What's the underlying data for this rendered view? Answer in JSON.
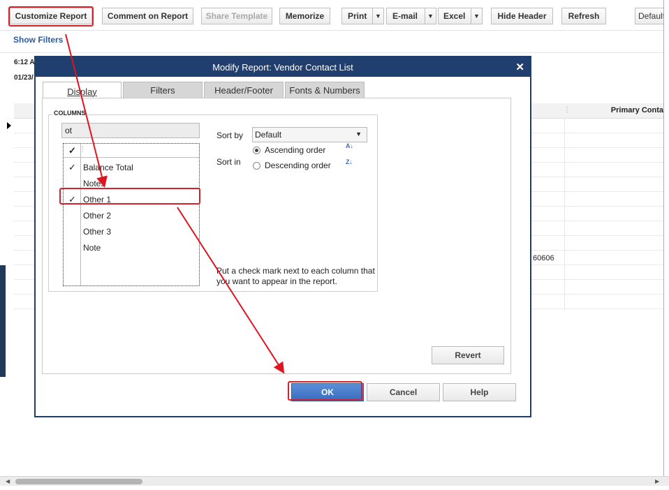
{
  "toolbar": {
    "customize": "Customize Report",
    "comment": "Comment on Report",
    "share": "Share Template",
    "memorize": "Memorize",
    "print": "Print",
    "email": "E-mail",
    "excel": "Excel",
    "hide_header": "Hide Header",
    "refresh": "Refresh",
    "default_select": "Default"
  },
  "filters": {
    "show_filters": "Show Filters"
  },
  "report": {
    "time": "6:12 A",
    "date": "01/23/",
    "column_header": "Primary Conta",
    "zip_value": "60606"
  },
  "dialog": {
    "title": "Modify Report: Vendor Contact List",
    "close": "✕",
    "tabs": [
      "Display",
      "Filters",
      "Header/Footer",
      "Fonts & Numbers"
    ],
    "columns_label": "COLUMNS",
    "search_value": "ot",
    "list_header_check": "✓",
    "columns": [
      {
        "check": "✓",
        "label": "Balance Total"
      },
      {
        "check": "",
        "label": "Notes"
      },
      {
        "check": "✓",
        "label": "Other 1"
      },
      {
        "check": "",
        "label": "Other 2"
      },
      {
        "check": "",
        "label": "Other 3"
      },
      {
        "check": "",
        "label": "Note"
      }
    ],
    "sort_by_label": "Sort by",
    "sort_by_value": "Default",
    "sort_in_label": "Sort in",
    "ascending": "Ascending order",
    "descending": "Descending order",
    "hint": "Put a check mark next to each column that you want to appear in the report.",
    "revert": "Revert",
    "ok": "OK",
    "cancel": "Cancel",
    "help": "Help"
  },
  "colors": {
    "highlight": "#d8202a",
    "titlebar": "#203f6e",
    "link": "#2d5aa0",
    "ok_button": "#3a6cc0"
  }
}
